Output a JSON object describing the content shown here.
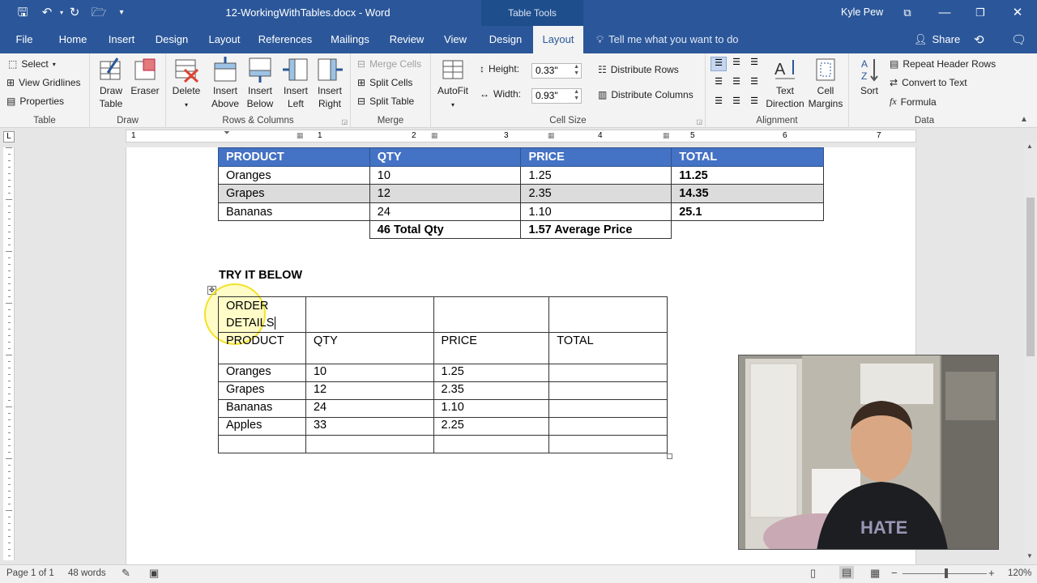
{
  "window": {
    "title": "12-WorkingWithTables.docx - Word",
    "context_tab_group": "Table Tools",
    "user": "Kyle Pew"
  },
  "tabs": [
    "File",
    "Home",
    "Insert",
    "Design",
    "Layout",
    "References",
    "Mailings",
    "Review",
    "View",
    "Design",
    "Layout"
  ],
  "tell_me": "Tell me what you want to do",
  "share": "Share",
  "ribbon": {
    "table": {
      "select": "Select",
      "view_gridlines": "View Gridlines",
      "properties": "Properties",
      "label": "Table"
    },
    "draw": {
      "draw_table": "Draw Table",
      "eraser": "Eraser",
      "label": "Draw"
    },
    "rows_columns": {
      "delete": "Delete",
      "insert_above": "Insert Above",
      "insert_below": "Insert Below",
      "insert_left": "Insert Left",
      "insert_right": "Insert Right",
      "label": "Rows & Columns"
    },
    "merge": {
      "merge_cells": "Merge Cells",
      "split_cells": "Split Cells",
      "split_table": "Split Table",
      "label": "Merge"
    },
    "cell_size": {
      "autofit": "AutoFit",
      "height_label": "Height:",
      "height_value": "0.33\"",
      "width_label": "Width:",
      "width_value": "0.93\"",
      "distribute_rows": "Distribute Rows",
      "distribute_columns": "Distribute Columns",
      "label": "Cell Size"
    },
    "alignment": {
      "text_direction": "Text Direction",
      "cell_margins": "Cell Margins",
      "label": "Alignment"
    },
    "data": {
      "sort": "Sort",
      "repeat_header_rows": "Repeat Header Rows",
      "convert_to_text": "Convert to Text",
      "formula": "Formula",
      "label": "Data"
    }
  },
  "ruler_numbers": [
    "1",
    "1",
    "2",
    "3",
    "4",
    "5",
    "6",
    "7"
  ],
  "table1": {
    "headers": [
      "PRODUCT",
      "QTY",
      "PRICE",
      "TOTAL"
    ],
    "rows": [
      [
        "Oranges",
        "10",
        "1.25",
        "11.25"
      ],
      [
        "Grapes",
        "12",
        "2.35",
        "14.35"
      ],
      [
        "Bananas",
        "24",
        "1.10",
        "25.1"
      ]
    ],
    "summary": [
      "46 Total Qty",
      "1.57 Average Price"
    ]
  },
  "try_heading": "TRY IT BELOW",
  "table2": {
    "title_line1": "ORDER",
    "title_line2": "DETAILS",
    "headers": [
      "PRODUCT",
      "QTY",
      "PRICE",
      "TOTAL"
    ],
    "rows": [
      [
        "Oranges",
        "10",
        "1.25",
        ""
      ],
      [
        "Grapes",
        "12",
        "2.35",
        ""
      ],
      [
        "Bananas",
        "24",
        "1.10",
        ""
      ],
      [
        "Apples",
        "33",
        "2.25",
        ""
      ]
    ]
  },
  "status": {
    "page": "Page 1 of 1",
    "words": "48 words",
    "zoom": "120%"
  },
  "colors": {
    "accent": "#2b579a",
    "table_header": "#4472c4",
    "band": "#dcdcdc"
  }
}
